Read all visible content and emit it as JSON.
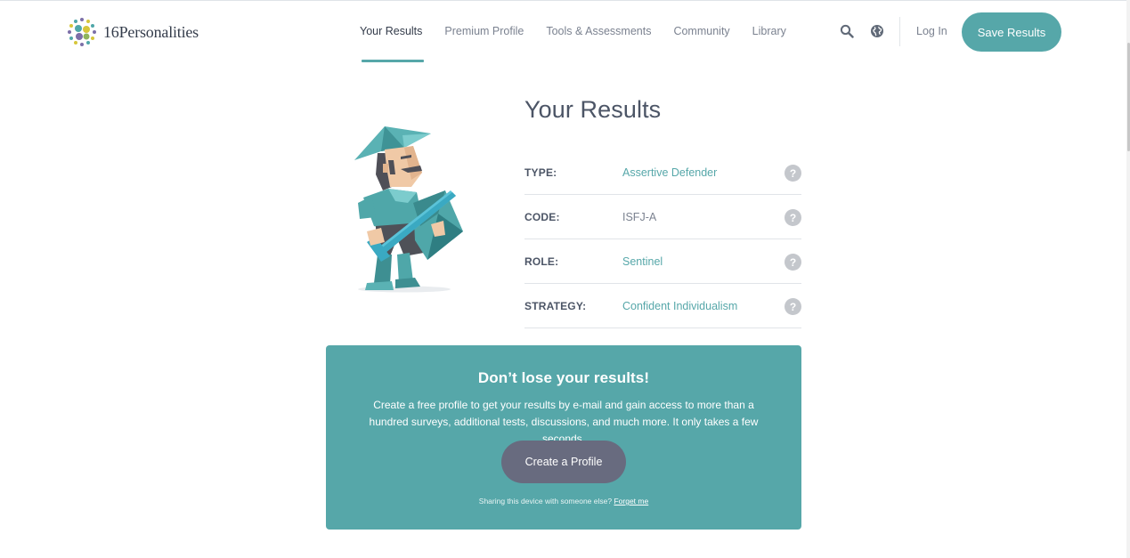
{
  "brand": {
    "logo_text": "16Personalities"
  },
  "nav": {
    "items": [
      {
        "label": "Your Results",
        "active": true
      },
      {
        "label": "Premium Profile",
        "active": false
      },
      {
        "label": "Tools & Assessments",
        "active": false
      },
      {
        "label": "Community",
        "active": false
      },
      {
        "label": "Library",
        "active": false
      }
    ],
    "login_label": "Log In",
    "save_label": "Save Results",
    "icons": [
      "search-icon",
      "globe-icon"
    ]
  },
  "results": {
    "title": "Your Results",
    "rows": [
      {
        "label": "TYPE:",
        "value": "Assertive Defender",
        "linked": true
      },
      {
        "label": "CODE:",
        "value": "ISFJ-A",
        "linked": false
      },
      {
        "label": "ROLE:",
        "value": "Sentinel",
        "linked": true
      },
      {
        "label": "STRATEGY:",
        "value": "Confident Individualism",
        "linked": true
      }
    ],
    "help_glyph": "?"
  },
  "cta": {
    "title": "Don’t lose your results!",
    "text": "Create a free profile to get your results by e-mail and gain access to more than a hundred surveys, additional tests, discussions, and much more. It only takes a few seconds.",
    "button_label": "Create a Profile",
    "footnote_prefix": "Sharing this device with someone else?",
    "footnote_link": "Forget me"
  },
  "colors": {
    "accent": "#56a7a9",
    "button_dark": "#686b7f",
    "heading": "#4c5566",
    "muted": "#7b8290"
  }
}
